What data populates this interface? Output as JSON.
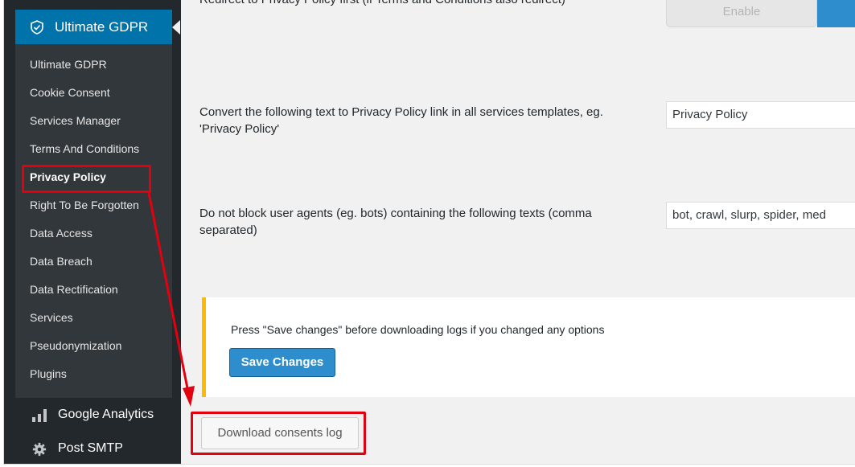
{
  "sidebar": {
    "plugin_title": "Ultimate GDPR",
    "submenu": [
      {
        "label": "Ultimate GDPR"
      },
      {
        "label": "Cookie Consent"
      },
      {
        "label": "Services Manager"
      },
      {
        "label": "Terms And Conditions"
      },
      {
        "label": "Privacy Policy",
        "current": true
      },
      {
        "label": "Right To Be Forgotten"
      },
      {
        "label": "Data Access"
      },
      {
        "label": "Data Breach"
      },
      {
        "label": "Data Rectification"
      },
      {
        "label": "Services"
      },
      {
        "label": "Pseudonymization"
      },
      {
        "label": "Plugins"
      }
    ],
    "other_items": [
      {
        "label": "Google Analytics",
        "icon": "chart-icon"
      },
      {
        "label": "Post SMTP",
        "icon": "gear-icon"
      }
    ]
  },
  "settings": {
    "partial_label": "Redirect to Privacy Policy first (if Terms and Conditions also redirect)",
    "partial_toggle_label": "Enable",
    "convert_text": {
      "label": "Convert the following text to Privacy Policy link in all services templates, eg. 'Privacy Policy'",
      "value": "Privacy Policy"
    },
    "user_agents": {
      "label": "Do not block user agents (eg. bots) containing the following texts (comma separated)",
      "value": "bot, crawl, slurp, spider, med"
    }
  },
  "notice": {
    "text": "Press \"Save changes\" before downloading logs if you changed any options",
    "save_label": "Save Changes"
  },
  "download_label": "Download consents log",
  "colors": {
    "sidebar_bg": "#23282d",
    "submenu_bg": "#32373c",
    "accent": "#0073aa",
    "button_blue": "#2e8ecd",
    "notice_border": "#ffb900",
    "annotation_red": "#e3000f"
  }
}
